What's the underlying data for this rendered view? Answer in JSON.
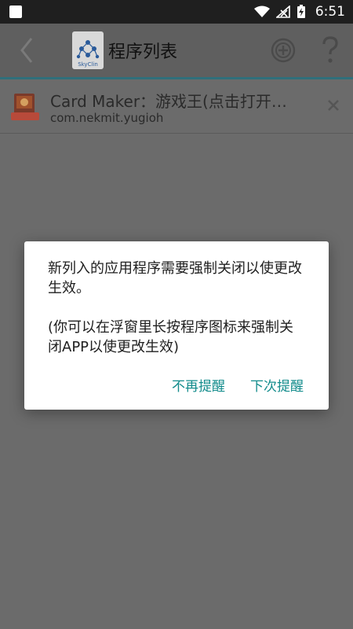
{
  "status_bar": {
    "time": "6:51",
    "icons": [
      "wifi-icon",
      "cell-signal-off-icon",
      "battery-charging-icon"
    ],
    "left_icon": "notification-square-icon"
  },
  "app_bar": {
    "title": "程序列表",
    "logo_text": "SkyClin",
    "icons": [
      "back-chevron-icon",
      "add-circle-icon",
      "help-question-icon"
    ]
  },
  "app_list": [
    {
      "name": "Card Maker：游戏王(点击打开…",
      "package": "com.nekmit.yugioh",
      "icon": "card-maker-app-icon"
    }
  ],
  "dialog": {
    "message_1": "新列入的应用程序需要强制关闭以使更改生效。",
    "message_2": "(你可以在浮窗里长按程序图标来强制关闭APP以使更改生效)",
    "button_dont_remind": "不再提醒",
    "button_remind_next": "下次提醒"
  },
  "colors": {
    "accent": "#138c8c",
    "appbar_line": "#2f6f7b",
    "scrim": "#6b6b6b"
  }
}
